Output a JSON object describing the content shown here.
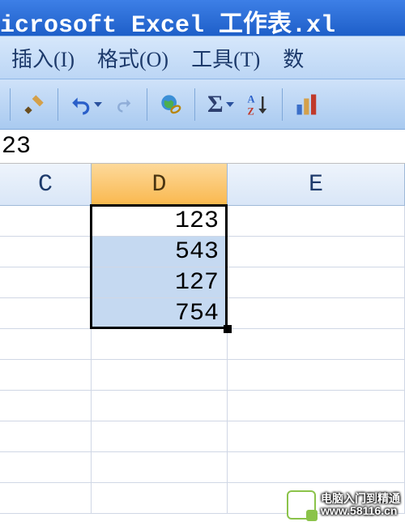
{
  "window": {
    "title": "icrosoft Excel 工作表.xl"
  },
  "menu": {
    "insert": "插入(I)",
    "format": "格式(O)",
    "tools": "工具(T)",
    "data": "数"
  },
  "formula_bar": {
    "value": "23"
  },
  "columns": {
    "c": "C",
    "d": "D",
    "e": "E"
  },
  "chart_data": {
    "type": "table",
    "columns": [
      "D"
    ],
    "rows": [
      {
        "D": 123
      },
      {
        "D": 543
      },
      {
        "D": 127
      },
      {
        "D": 754
      }
    ]
  },
  "cells": {
    "d1": "123",
    "d2": "543",
    "d3": "127",
    "d4": "754"
  },
  "watermark": {
    "line1": "电脑入门到精通",
    "line2": "www.58116.cn"
  }
}
